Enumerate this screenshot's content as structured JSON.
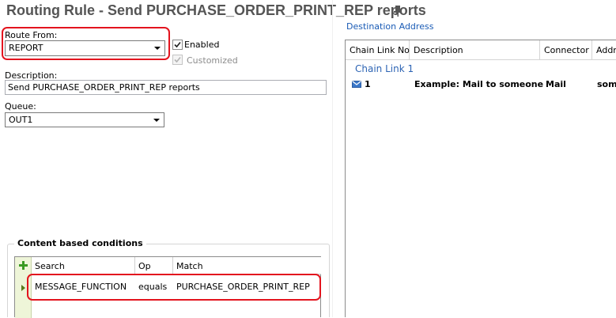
{
  "window": {
    "title": "Routing Rule - Send PURCHASE_ORDER_PRINT_REP reports"
  },
  "form": {
    "route_from_label": "Route From:",
    "route_from_value": "REPORT",
    "enabled_label": "Enabled",
    "enabled_checked": true,
    "customized_label": "Customized",
    "customized_checked": true,
    "description_label": "Description:",
    "description_value": "Send PURCHASE_ORDER_PRINT_REP reports",
    "queue_label": "Queue:",
    "queue_value": "OUT1"
  },
  "conditions": {
    "group_title": "Content based conditions",
    "columns": [
      "Search",
      "Op",
      "Match"
    ],
    "rows": [
      {
        "search": "MESSAGE_FUNCTION",
        "op": "equals",
        "match": "PURCHASE_ORDER_PRINT_REP"
      }
    ]
  },
  "destination": {
    "label": "Destination Address",
    "columns": [
      "Chain Link No",
      "Description",
      "Connector",
      "Address"
    ],
    "group_label": "Chain Link 1",
    "rows": [
      {
        "chain_link_no": "1",
        "description": "Example: Mail to someone",
        "connector": "Mail",
        "address": "someone"
      }
    ]
  },
  "colors": {
    "highlight_red": "#e3141e",
    "link_blue": "#1a5bb5",
    "add_green": "#3a9a22",
    "title_gray": "#555555"
  },
  "icons": {
    "pin": "pin-icon",
    "add": "add-icon",
    "row_indicator": "row-arrow-icon",
    "mail": "mail-icon",
    "dropdown": "chevron-down-icon"
  }
}
